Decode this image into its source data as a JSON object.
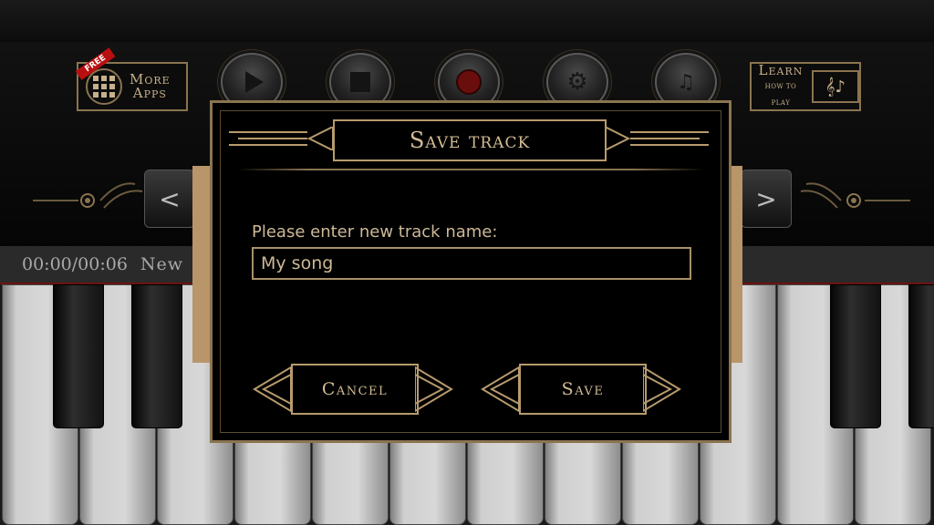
{
  "toolbar": {
    "free_badge": "FREE",
    "more_apps_line1": "More",
    "more_apps_line2": "Apps",
    "learn_line1": "Learn",
    "learn_line2": "HOW TO PLAY",
    "buttons": [
      "play-icon",
      "stop-icon",
      "record-icon",
      "gear-icon",
      "music-file-icon"
    ]
  },
  "nav": {
    "prev": "<",
    "next": ">"
  },
  "status": {
    "time": "00:00/00:06",
    "track_title": "New"
  },
  "dialog": {
    "title": "Save track",
    "prompt": "Please enter new track name:",
    "input_value": "My song",
    "cancel_label": "Cancel",
    "save_label": "Save"
  },
  "colors": {
    "gold": "#b79b6d",
    "record_red": "#6a0d0d",
    "background": "#000000"
  }
}
